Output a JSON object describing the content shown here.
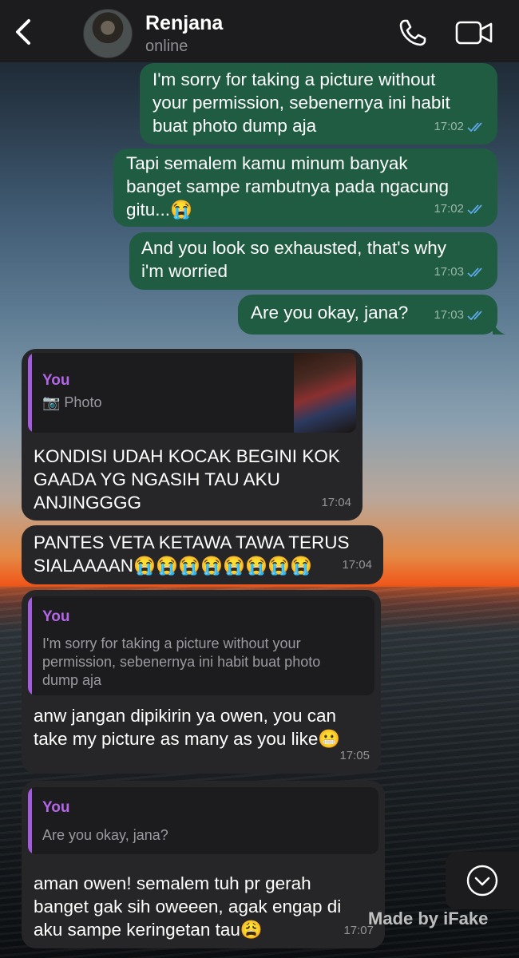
{
  "header": {
    "contact_name": "Renjana",
    "status": "online"
  },
  "messages": [
    {
      "dir": "out",
      "text_lines": [
        "I'm sorry for taking a picture without",
        "your permission, sebenernya ini habit",
        "buat photo dump aja"
      ],
      "time": "17:02"
    },
    {
      "dir": "out",
      "text_lines": [
        "Tapi semalem kamu minum banyak",
        "banget sampe rambutnya pada ngacung",
        "gitu...😭"
      ],
      "time": "17:02"
    },
    {
      "dir": "out",
      "text_lines": [
        "And you look so exhausted, that's why",
        "i'm worried"
      ],
      "time": "17:03"
    },
    {
      "dir": "out",
      "text_lines": [
        "Are you okay, jana?"
      ],
      "time": "17:03"
    },
    {
      "dir": "in",
      "quote_name": "You",
      "quote_text": "📷 Photo",
      "text_lines": [
        "KONDISI UDAH KOCAK BEGINI KOK",
        "GAADA YG NGASIH TAU AKU",
        "ANJINGGGG"
      ],
      "time": "17:04"
    },
    {
      "dir": "in",
      "text_lines": [
        "PANTES VETA KETAWA TAWA TERUS",
        "SIALAAAAN😭😭😭😭😭😭😭😭"
      ],
      "time": "17:04"
    },
    {
      "dir": "in",
      "quote_name": "You",
      "quote_lines": [
        "I'm sorry for taking a picture without your",
        "permission, sebenernya ini habit buat photo",
        "dump aja"
      ],
      "text_lines": [
        "anw jangan dipikirin ya owen, you can",
        "take my picture as many as you like😬"
      ],
      "time": "17:05"
    },
    {
      "dir": "in",
      "quote_name": "You",
      "quote_text": "Are you okay, jana?",
      "text_lines": [
        "aman owen! semalem tuh pr gerah",
        "banget gak sih oweeen, agak engap di",
        "aku sampe keringetan tau😩"
      ],
      "time": "17:07"
    }
  ],
  "watermark": "Made by iFake",
  "colors": {
    "outgoing_bubble": "#1f5c42",
    "incoming_bubble": "#262628",
    "quote_accent": "#a35cdc",
    "read_check": "#5fa8e8"
  }
}
